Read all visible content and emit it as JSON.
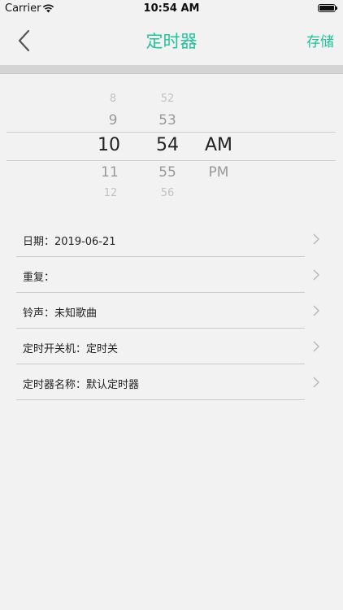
{
  "status": {
    "carrier": "Carrier",
    "time": "10:54 AM"
  },
  "nav": {
    "title": "定时器",
    "save_label": "存储"
  },
  "picker": {
    "hours": {
      "above2": "8",
      "above1": "9",
      "selected": "10",
      "below1": "11",
      "below2": "12"
    },
    "minutes": {
      "above2": "52",
      "above1": "53",
      "selected": "54",
      "below1": "55",
      "below2": "56"
    },
    "period": {
      "selected": "AM",
      "below1": "PM"
    }
  },
  "rows": [
    {
      "label": "日期：2019-06-21"
    },
    {
      "label": "重复："
    },
    {
      "label": "铃声：未知歌曲"
    },
    {
      "label": "定时开关机：定时关"
    },
    {
      "label": "定时器名称：默认定时器"
    }
  ],
  "colors": {
    "accent": "#22c29a"
  }
}
